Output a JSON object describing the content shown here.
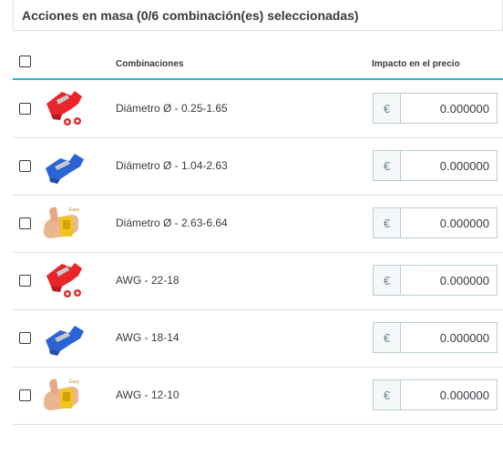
{
  "header": {
    "title": "Acciones en masa (0/6 combinación(es) seleccionadas)"
  },
  "table": {
    "col_combinations": "Combinaciones",
    "col_price_impact": "Impacto en el precio",
    "rows": [
      {
        "name": "Diámetro Ø - 0.25-1.65",
        "currency": "€",
        "price": "0.000000",
        "thumb": "red-connector"
      },
      {
        "name": "Diámetro Ø - 1.04-2.63",
        "currency": "€",
        "price": "0.000000",
        "thumb": "blue-connector"
      },
      {
        "name": "Diámetro Ø - 2.63-6.64",
        "currency": "€",
        "price": "0.000000",
        "thumb": "yellow-connector"
      },
      {
        "name": "AWG - 22-18",
        "currency": "€",
        "price": "0.000000",
        "thumb": "red-connector"
      },
      {
        "name": "AWG - 18-14",
        "currency": "€",
        "price": "0.000000",
        "thumb": "blue-connector"
      },
      {
        "name": "AWG - 12-10",
        "currency": "€",
        "price": "0.000000",
        "thumb": "yellow-connector"
      }
    ]
  },
  "colors": {
    "accent": "#25b9d7",
    "red": "#e8262a",
    "blue": "#2a63d4",
    "yellow": "#f2c519"
  }
}
